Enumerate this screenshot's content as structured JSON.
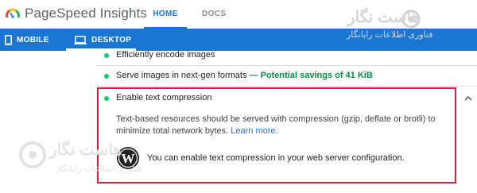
{
  "header": {
    "app_title": "PageSpeed Insights",
    "tabs": [
      {
        "label": "HOME",
        "active": true
      },
      {
        "label": "DOCS",
        "active": false
      }
    ]
  },
  "device_bar": {
    "mobile_label": "MOBILE",
    "desktop_label": "DESKTOP",
    "active": "DESKTOP",
    "color": "#1976d2"
  },
  "audits": [
    {
      "title": "Efficiently encode images",
      "status": "pass"
    },
    {
      "title": "Serve images in next-gen formats",
      "savings": "— Potential savings of 41 KiB",
      "status": "pass"
    },
    {
      "title": "Enable text compression",
      "status": "pass",
      "expanded": true
    }
  ],
  "expanded": {
    "description": "Text-based resources should be served with compression (gzip, deflate or brotli) to minimize total network bytes.",
    "learn_more": "Learn more",
    "wordpress_hint": "You can enable text compression in your web server configuration."
  },
  "watermark": {
    "name": "هاست نگار",
    "subtitle": "فناوری اطلاعات رایانگار"
  },
  "colors": {
    "accent": "#1a73e8",
    "pass_dot": "#0cce6b",
    "highlight_border": "#e21b3c"
  },
  "icons": {
    "app_logo": "pagespeed-gauge-icon",
    "mobile": "smartphone-icon",
    "desktop": "laptop-icon",
    "expand": "chevron-up-icon",
    "wordpress": "wordpress-logo"
  }
}
